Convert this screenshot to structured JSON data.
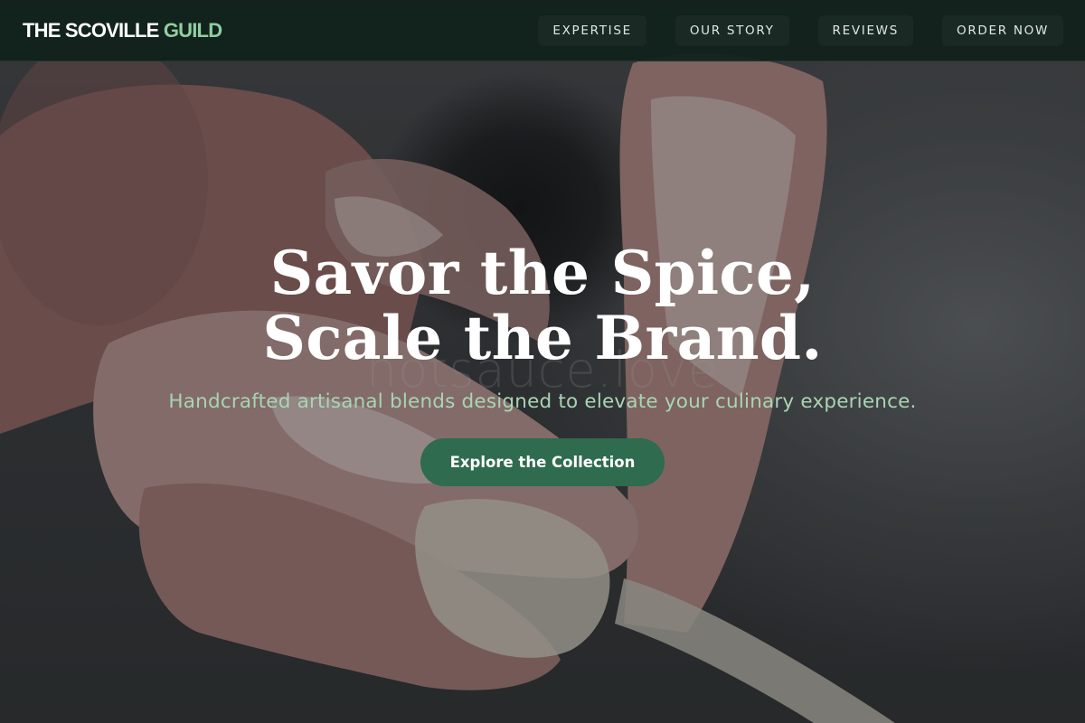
{
  "nav": {
    "brand_primary": "THE SCOVILLE",
    "brand_accent": "GUILD",
    "links": [
      {
        "label": "EXPERTISE"
      },
      {
        "label": "OUR STORY"
      },
      {
        "label": "REVIEWS"
      },
      {
        "label": "ORDER NOW"
      }
    ]
  },
  "hero": {
    "title_line1": "Savor the Spice,",
    "title_line2": "Scale the Brand.",
    "subtitle": "Handcrafted artisanal blends designed to elevate your culinary experience.",
    "cta_label": "Explore the Collection",
    "watermark": "hotsauce.love"
  },
  "colors": {
    "nav_background": "#10201b",
    "brand_accent": "#8fcf9f",
    "subtitle": "#a8d5b4",
    "cta_background": "#2f6b4e"
  }
}
